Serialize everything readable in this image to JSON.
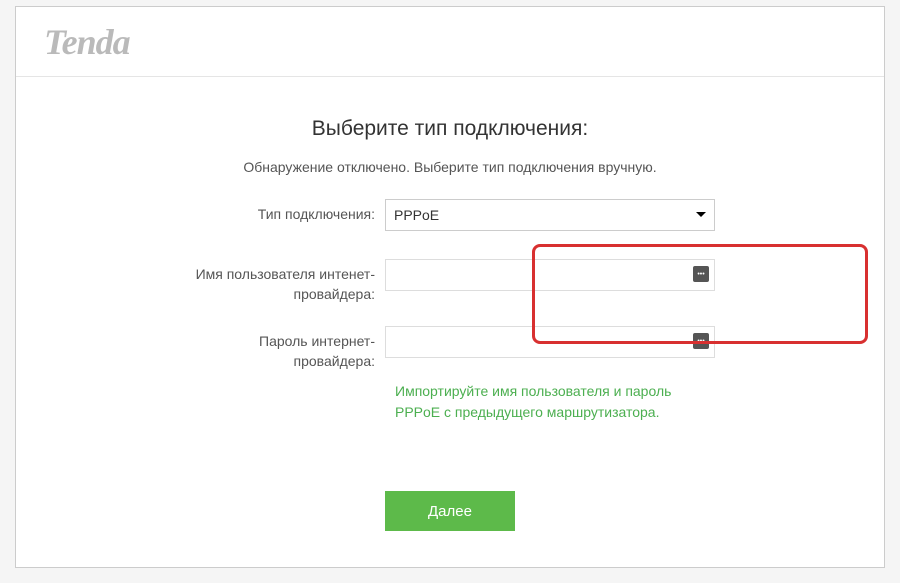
{
  "logo": "Tenda",
  "title": "Выберите тип подключения:",
  "subtitle": "Обнаружение отключено. Выберите тип подключения вручную.",
  "labels": {
    "connection_type": "Тип подключения:",
    "username": "Имя пользователя интенет-провайдера:",
    "password": "Пароль интернет-провайдера:"
  },
  "fields": {
    "connection_type_value": "PPPoE",
    "username_value": "",
    "password_value": ""
  },
  "hint": "Импортируйте имя пользователя и пароль PPPoE с предыдущего маршрутизатора.",
  "buttons": {
    "next": "Далее"
  }
}
